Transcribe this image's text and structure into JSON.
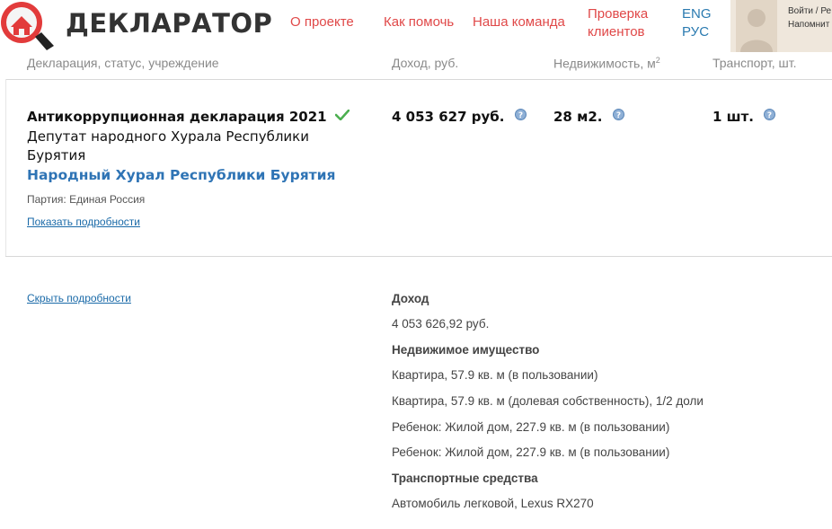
{
  "header": {
    "brand": "ДЕКЛАРАТОР",
    "nav": {
      "about": "О проекте",
      "help": "Как помочь",
      "team": "Наша команда",
      "check_clients": "Проверка клиентов"
    },
    "lang": {
      "en": "ENG",
      "ru": "РУС"
    },
    "user": {
      "login": "Войти / Ре",
      "remind": "Напомнит"
    }
  },
  "columns": {
    "declaration": "Декларация, статус, учреждение",
    "income": "Доход, руб.",
    "realty": "Недвижимость, м",
    "realty_sup": "2",
    "transport": "Транспорт, шт."
  },
  "declaration": {
    "title": "Антикоррупционная декларация 2021",
    "position": "Депутат народного Хурала Республики Бурятия",
    "organization": "Народный Хурал Республики Бурятия",
    "party": "Партия: Единая Россия",
    "show_details": "Показать подробности",
    "income": "4 053 627 руб.",
    "realty": "28 м2.",
    "transport": "1 шт."
  },
  "details": {
    "hide_details": "Скрыть подробности",
    "income_heading": "Доход",
    "income_value": "4 053 626,92 руб.",
    "realty_heading": "Недвижимое имущество",
    "realty_items": [
      "Квартира, 57.9 кв. м (в пользовании)",
      "Квартира, 57.9 кв. м (долевая собственность), 1/2 доли",
      "Ребенок: Жилой дом, 227.9 кв. м (в пользовании)",
      "Ребенок: Жилой дом, 227.9 кв. м (в пользовании)"
    ],
    "transport_heading": "Транспортные средства",
    "transport_items": [
      "Автомобиль легковой, Lexus RX270"
    ]
  },
  "colors": {
    "nav_red": "#e04848",
    "lang_blue": "#2a7ab0",
    "org_blue": "#2f74b5",
    "check_green": "#4caf50"
  },
  "icons": {
    "logo": "magnifier-house-logo-icon",
    "verified": "check-icon",
    "help": "question-circle-icon",
    "avatar": "user-avatar-icon"
  }
}
